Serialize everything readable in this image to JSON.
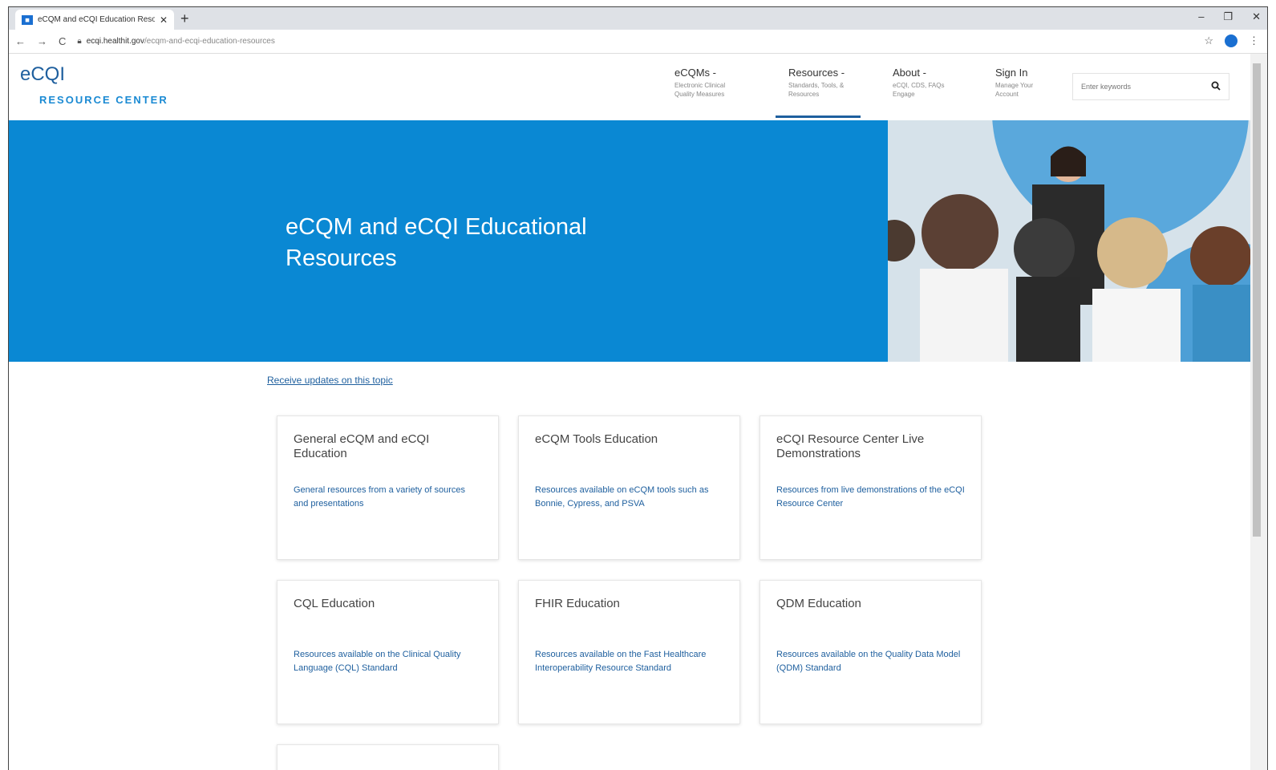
{
  "browser": {
    "tab_title": "eCQM and eCQI Education Reso",
    "url_host": "ecqi.healthit.gov",
    "url_path": "/ecqm-and-ecqi-education-resources"
  },
  "header": {
    "logo_main": "eCQI",
    "logo_sub": "RESOURCE CENTER",
    "nav": [
      {
        "title": "eCQMs -",
        "sub1": "Electronic Clinical",
        "sub2": "Quality Measures"
      },
      {
        "title": "Resources -",
        "sub1": "Standards, Tools, &",
        "sub2": "Resources"
      },
      {
        "title": "About -",
        "sub1": "eCQI, CDS, FAQs",
        "sub2": "Engage"
      },
      {
        "title": "Sign In",
        "sub1": "Manage Your",
        "sub2": "Account"
      }
    ],
    "search_placeholder": "Enter keywords"
  },
  "hero": {
    "title": "eCQM and eCQI Educational Resources"
  },
  "updates_link": "Receive updates on this topic",
  "cards": [
    {
      "title": "General eCQM and eCQI Education",
      "desc": "General resources from a variety of sources and presentations"
    },
    {
      "title": "eCQM Tools Education",
      "desc": "Resources available on eCQM tools such as Bonnie, Cypress, and PSVA"
    },
    {
      "title": "eCQI Resource Center Live Demonstrations",
      "desc": "Resources from live demonstrations of the eCQI Resource Center"
    },
    {
      "title": "CQL Education",
      "desc": "Resources available on the Clinical Quality Language (CQL) Standard"
    },
    {
      "title": "FHIR Education",
      "desc": "Resources available on the Fast Healthcare Interoperability Resource Standard"
    },
    {
      "title": "QDM Education",
      "desc": "Resources available on the Quality Data Model (QDM) Standard"
    }
  ],
  "colors": {
    "hero_blue": "#0a88d3",
    "link_blue": "#1e5f9e"
  }
}
